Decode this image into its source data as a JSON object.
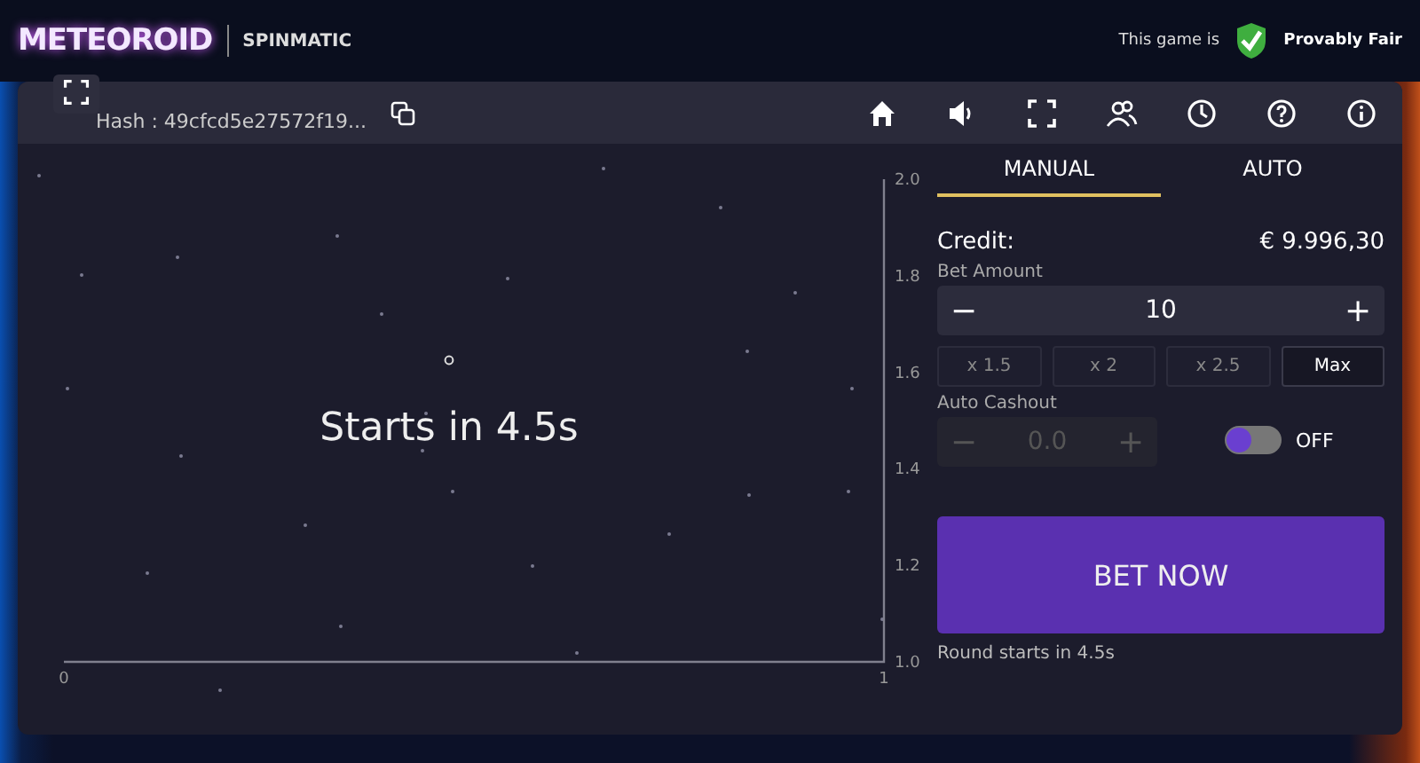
{
  "header": {
    "logo": "METEOROID",
    "brand": "SPINMATIC",
    "fair_prefix": "This game is",
    "fair_label": "Provably Fair"
  },
  "toolbar": {
    "hash": "Hash : 49cfcd5e27572f19..."
  },
  "game": {
    "message": "Starts in 4.5s",
    "chart_data": {
      "type": "line",
      "xticks": [
        {
          "value": 0,
          "label": "0"
        },
        {
          "value": 1,
          "label": "1"
        }
      ],
      "yticks": [
        {
          "value": 1.0,
          "label": "1.0"
        },
        {
          "value": 1.2,
          "label": "1.2"
        },
        {
          "value": 1.4,
          "label": "1.4"
        },
        {
          "value": 1.6,
          "label": "1.6"
        },
        {
          "value": 1.8,
          "label": "1.8"
        },
        {
          "value": 2.0,
          "label": "2.0"
        }
      ],
      "xlim": [
        0,
        1
      ],
      "ylim": [
        1.0,
        2.0
      ]
    }
  },
  "tabs": [
    {
      "label": "MANUAL",
      "selected": true
    },
    {
      "label": "AUTO",
      "selected": false
    }
  ],
  "credit": {
    "label": "Credit:",
    "value": "€ 9.996,30"
  },
  "bet": {
    "label": "Bet Amount",
    "value": "10",
    "minus": "−",
    "plus": "+"
  },
  "multipliers": [
    {
      "label": "x 1.5",
      "kind": "multiplier"
    },
    {
      "label": "x 2",
      "kind": "multiplier"
    },
    {
      "label": "x 2.5",
      "kind": "multiplier"
    },
    {
      "label": "Max",
      "kind": "max"
    }
  ],
  "auto_cashout": {
    "label": "Auto Cashout",
    "value": "0.0",
    "minus": "−",
    "plus": "+",
    "disabled": true,
    "toggle_on": false,
    "toggle_label": "OFF"
  },
  "bet_button": "BET NOW",
  "status": "Round starts in 4.5s"
}
